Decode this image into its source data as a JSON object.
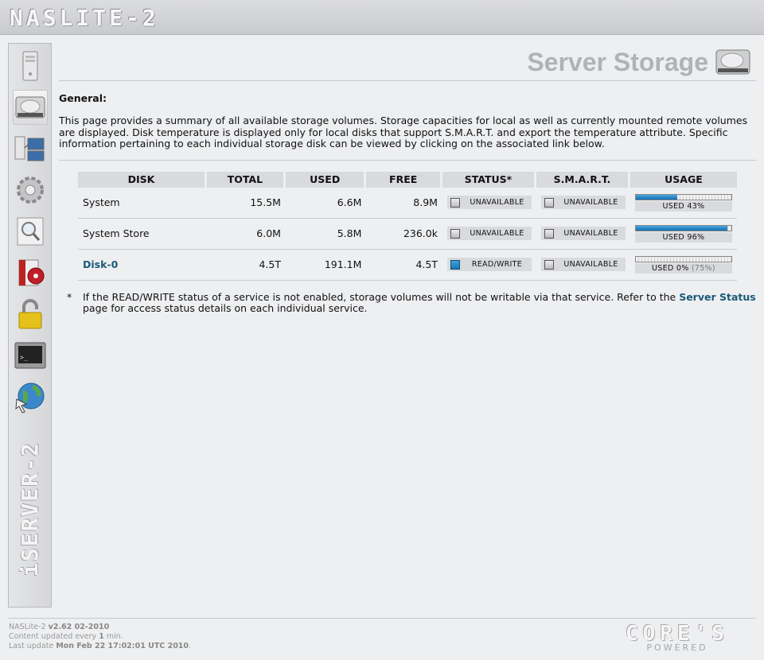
{
  "header": {
    "logo_text": "NASLITE-2"
  },
  "sidebar": {
    "items": [
      {
        "name": "server-icon"
      },
      {
        "name": "disk-icon"
      },
      {
        "name": "network-icon"
      },
      {
        "name": "gear-icon"
      },
      {
        "name": "search-icon"
      },
      {
        "name": "media-icon"
      },
      {
        "name": "lock-icon"
      },
      {
        "name": "terminal-icon"
      },
      {
        "name": "globe-icon"
      }
    ],
    "brand_text": "iSERVER-2"
  },
  "page": {
    "title": "Server Storage",
    "section_heading": "General:",
    "intro": "This page provides a summary of all available storage volumes. Storage capacities for local as well as currently mounted remote volumes are displayed. Disk temperature is displayed only for local disks that support S.M.A.R.T. and export the temperature attribute. Specific information pertaining to each individual storage disk can be viewed by clicking on the associated link below."
  },
  "table": {
    "headers": [
      "DISK",
      "TOTAL",
      "USED",
      "FREE",
      "STATUS*",
      "S.M.A.R.T.",
      "USAGE"
    ],
    "rows": [
      {
        "disk": "System",
        "total": "15.5M",
        "used": "6.6M",
        "free": "8.9M",
        "status": "UNAVAILABLE",
        "status_on": false,
        "smart": "UNAVAILABLE",
        "usage_label": "USED 43%",
        "usage_extra": "",
        "usage_fraction": 0.43
      },
      {
        "disk": "System Store",
        "total": "6.0M",
        "used": "5.8M",
        "free": "236.0k",
        "status": "UNAVAILABLE",
        "status_on": false,
        "smart": "UNAVAILABLE",
        "usage_label": "USED 96%",
        "usage_extra": "",
        "usage_fraction": 0.96
      },
      {
        "disk": "Disk-0",
        "total": "4.5T",
        "used": "191.1M",
        "free": "4.5T",
        "status": "READ/WRITE",
        "status_on": true,
        "smart": "UNAVAILABLE",
        "usage_label": "USED 0%",
        "usage_extra": "(75%)",
        "usage_fraction": 0.0
      }
    ]
  },
  "note": {
    "star": "*",
    "text_before": "If the READ/WRITE status of a service is not enabled, storage volumes will not be writable via that service. Refer to the ",
    "link": "Server Status",
    "text_after": " page for access status details on each individual service."
  },
  "footer": {
    "line1_prefix": "NASLite-2 ",
    "line1_version": "v2.62 02-2010",
    "line2_prefix": "Content updated every ",
    "line2_value": "1",
    "line2_suffix": " min.",
    "line3_prefix": "Last update ",
    "line3_value": "Mon Feb 22 17:02:01 UTC 2010",
    "line3_suffix": "."
  },
  "powered": {
    "brand": "CORE'S",
    "sub": "POWERED"
  },
  "colors": {
    "accent": "#1b5a78",
    "bar_fill": "#1f82c3",
    "background": "#eeeff1"
  }
}
